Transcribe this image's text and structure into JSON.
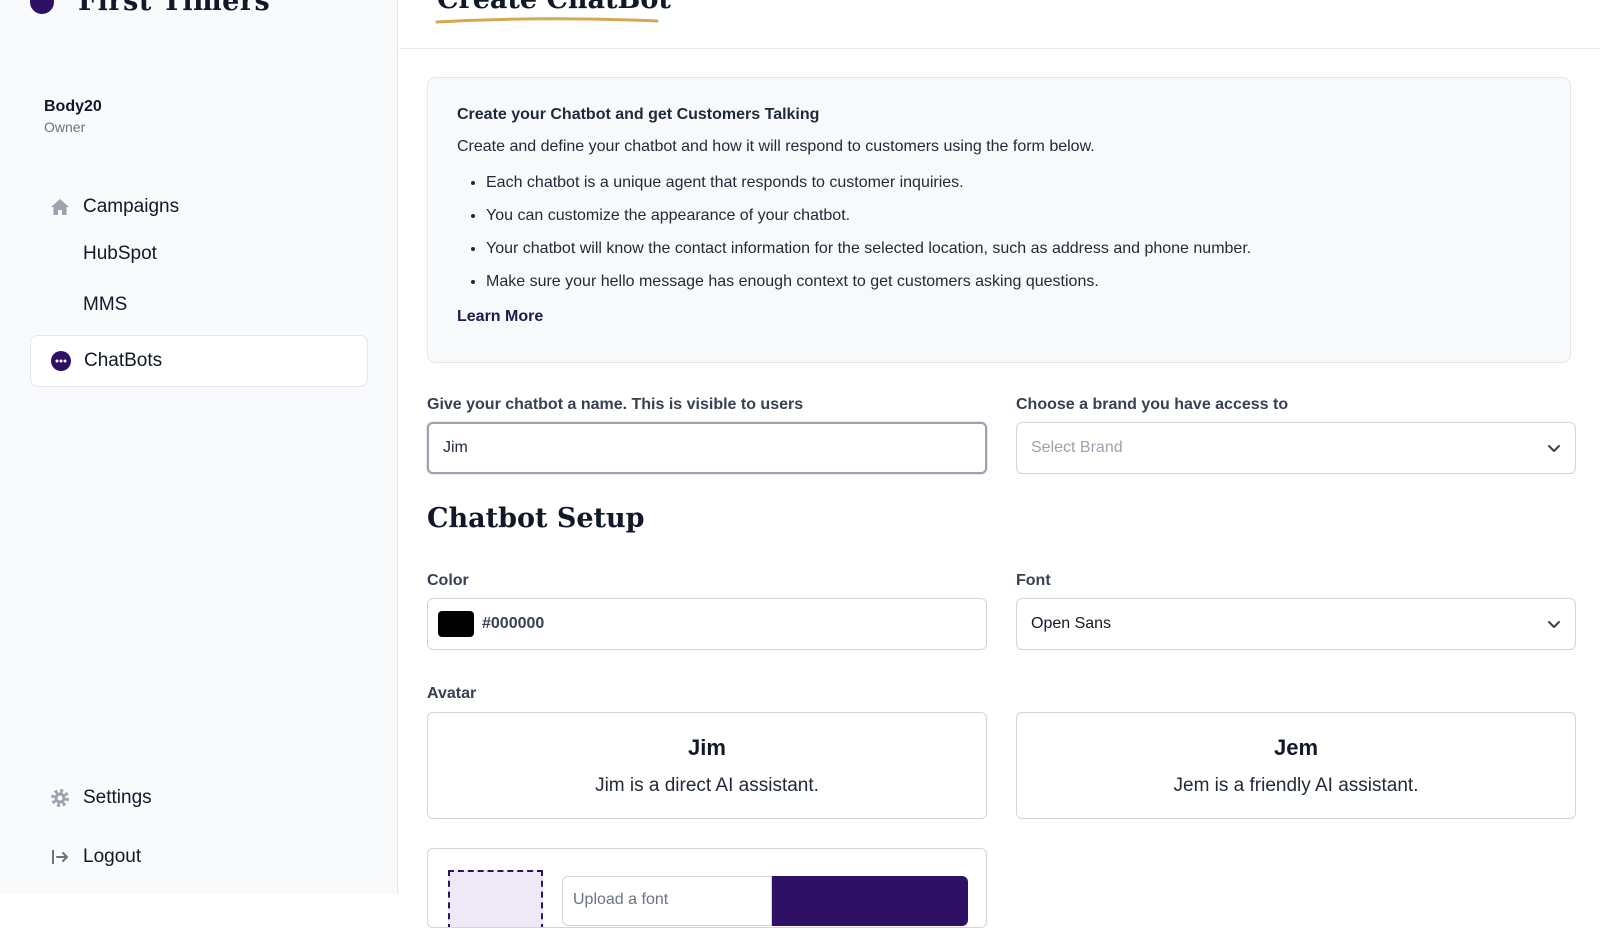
{
  "sidebar": {
    "brand": "First Timers",
    "user": {
      "name": "Body20",
      "role": "Owner"
    },
    "nav": [
      {
        "label": "Campaigns",
        "icon": "home-icon"
      },
      {
        "label": "HubSpot",
        "icon": ""
      },
      {
        "label": "MMS",
        "icon": ""
      },
      {
        "label": "ChatBots",
        "icon": "chat-bubble-icon",
        "active": true
      }
    ],
    "footer": [
      {
        "label": "Settings",
        "icon": "gear-icon"
      },
      {
        "label": "Logout",
        "icon": "logout-icon"
      }
    ]
  },
  "page": {
    "title": "Create ChatBot"
  },
  "info": {
    "title": "Create your Chatbot and get Customers Talking",
    "description": "Create and define your chatbot and how it will respond to customers using the form below.",
    "bullets": [
      "Each chatbot is a unique agent that responds to customer inquiries.",
      "You can customize the appearance of your chatbot.",
      "Your chatbot will know the contact information for the selected location, such as address and phone number.",
      "Make sure your hello message has enough context to get customers asking questions."
    ],
    "link": "Learn More"
  },
  "form": {
    "name_label": "Give your chatbot a name. This is visible to users",
    "name_value": "Jim",
    "brand_label": "Choose a brand you have access to",
    "brand_placeholder": "Select Brand"
  },
  "setup": {
    "title": "Chatbot Setup",
    "color_label": "Color",
    "color_value": "#000000",
    "font_label": "Font",
    "font_value": "Open Sans",
    "avatar_label": "Avatar",
    "avatars": [
      {
        "name": "Jim",
        "description": "Jim is a direct AI assistant."
      },
      {
        "name": "Jem",
        "description": "Jem is a friendly AI assistant."
      }
    ],
    "upload_placeholder": "Upload a font"
  },
  "colors": {
    "accent": "#2e1065",
    "underline": "#d4a857",
    "border": "#d1d5db"
  }
}
